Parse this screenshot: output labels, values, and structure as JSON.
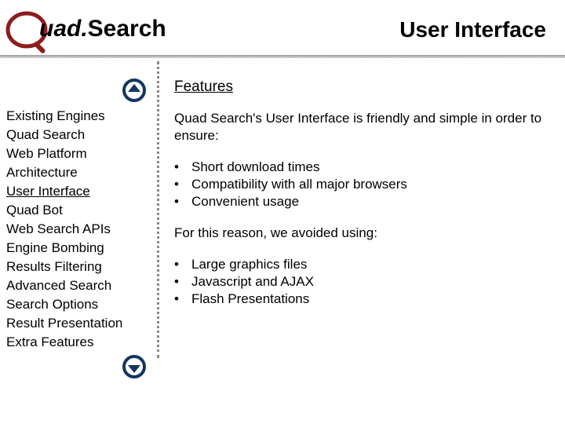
{
  "header": {
    "logo_word1": "uad.",
    "logo_word2": "Search",
    "title": "User Interface"
  },
  "sidebar": {
    "items": [
      {
        "label": "Existing Engines",
        "name": "existing-engines"
      },
      {
        "label": "Quad Search",
        "name": "quad-search"
      },
      {
        "label": "Web Platform",
        "name": "web-platform"
      },
      {
        "label": "Architecture",
        "name": "architecture"
      },
      {
        "label": "User Interface",
        "name": "user-interface"
      },
      {
        "label": "Quad Bot",
        "name": "quad-bot"
      },
      {
        "label": "Web Search APIs",
        "name": "web-search-apis"
      },
      {
        "label": "Engine Bombing",
        "name": "engine-bombing"
      },
      {
        "label": "Results Filtering",
        "name": "results-filtering"
      },
      {
        "label": "Advanced Search",
        "name": "advanced-search"
      },
      {
        "label": "Search Options",
        "name": "search-options"
      },
      {
        "label": "Result Presentation",
        "name": "result-presentation"
      },
      {
        "label": "Extra Features",
        "name": "extra-features"
      }
    ],
    "current_index": 4
  },
  "content": {
    "heading": "Features",
    "intro": "Quad Search's User Interface is friendly and simple in order to ensure:",
    "list1": [
      "Short download times",
      "Compatibility with all major browsers",
      "Convenient usage"
    ],
    "mid": "For this reason, we avoided using:",
    "list2": [
      "Large graphics files",
      "Javascript and AJAX",
      "Flash Presentations"
    ],
    "bullet_glyph": "•"
  }
}
